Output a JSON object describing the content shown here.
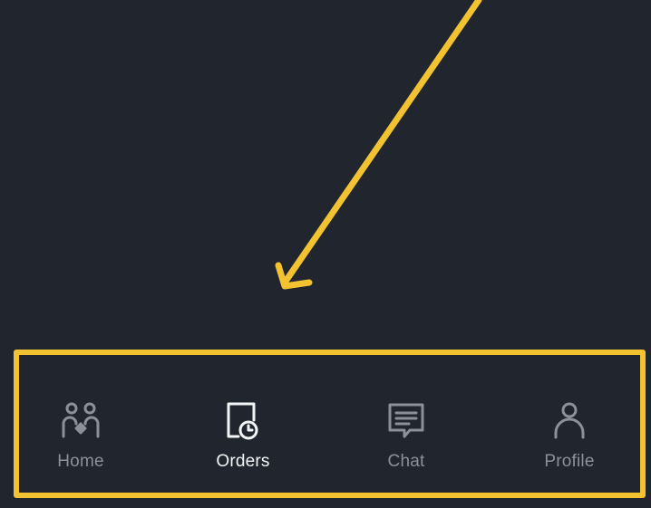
{
  "colors": {
    "background": "#21252e",
    "annotation": "#f2c230",
    "tab_active": "#f4f5f7",
    "tab_inactive": "#8b9099"
  },
  "tabbar": {
    "active_tab": "orders",
    "tabs": [
      {
        "id": "home",
        "label": "Home",
        "icon": "two-people-diamond-icon"
      },
      {
        "id": "orders",
        "label": "Orders",
        "icon": "document-clock-icon"
      },
      {
        "id": "chat",
        "label": "Chat",
        "icon": "chat-bubble-icon"
      },
      {
        "id": "profile",
        "label": "Profile",
        "icon": "person-icon"
      }
    ]
  }
}
